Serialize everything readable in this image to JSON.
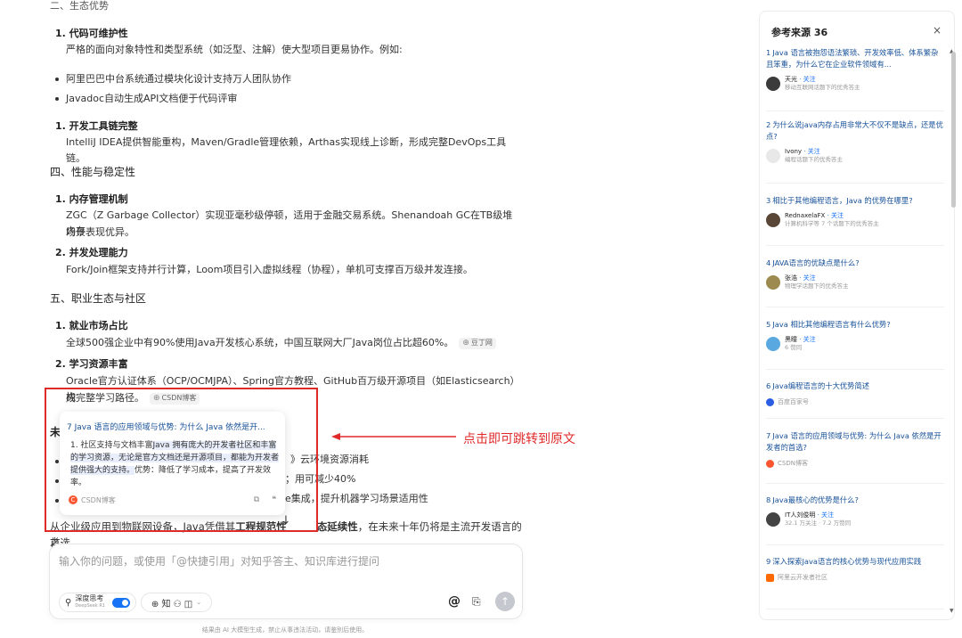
{
  "article": {
    "top_heading": "二、生态优势",
    "item1_title": "1. 代码可维护性",
    "item1_text": "严格的面向对象特性和类型系统（如泛型、注解）使大型项目更易协作。例如:",
    "bullet1": "阿里巴巴中台系统通过模块化设计支持万人团队协作",
    "bullet2": "Javadoc自动生成API文档便于代码评审",
    "item2_title": "1. 开发工具链完整",
    "item2_text": "IntelliJ IDEA提供智能重构，Maven/Gradle管理依赖，Arthas实现线上诊断，形成完整DevOps工具链。",
    "section4": "四、性能与稳定性",
    "item3_title": "1. 内存管理机制",
    "item3_text_a": "ZGC（Z Garbage Collector）实现亚毫秒级停顿，适用于金融交易系统。Shenandoah GC在TB级堆内存",
    "item3_text_b": "场景表现优异。",
    "item4_title": "2. 并发处理能力",
    "item4_text": "Fork/Join框架支持并行计算，Loom项目引入虚拟线程（协程），单机可支撑百万级并发连接。",
    "section5": "五、职业生态与社区",
    "item5_title": "1. 就业市场占比",
    "item5_text": "全球500强企业中有90%使用Java开发核心系统，中国互联网大厂Java岗位占比超60%。",
    "item5_source": "豆丁网",
    "item6_title": "2. 学习资源丰富",
    "item6_text_a": "Oracle官方认证体系（OCP/OCMJPA）、Spring官方教程、GitHub百万级开源项目（如Elasticsearch）构",
    "item6_text_b": "成完整学习路径。",
    "item6_source": "CSDN博客",
    "hidden_head": "未",
    "bullet3_tail": "》云环境资源消耗",
    "bullet4_tail": "；用可减少40%",
    "bullet5_tail": "e集成，提升机器学习场景适用性",
    "conclusion_a": "从企业级应用到物联网设备，Java凭借其",
    "conclusion_b": "工程规范性",
    "conclusion_c": "态延续性",
    "conclusion_d": "，在未来十年仍将是主流开发语言的首选",
    "conclusion_e": "之"
  },
  "popup": {
    "title": "7 Java 语言的应用领域与优势: 为什么 Java 依然是开...",
    "body_prefix": "1. 社区支持与文档丰富",
    "body_highlight": "Java 拥有庞大的开发者社区和丰富的学习资源，无论是官方文档还是开源项目，都能为开发者提供强大的支持。",
    "body_suffix": "优势：降低了学习成本，提高了开发效率。",
    "source": "CSDN博客",
    "csdn_glyph": "C",
    "copy_icon": "⧉",
    "quote_icon": "❝"
  },
  "annotation": "点击即可跳转到原文",
  "scroll_down_icon": "↓",
  "input": {
    "placeholder": "输入你的问题，或使用「@快捷引用」对知乎答主、知识库进行提问",
    "deep_label": "深度思考",
    "deep_sub": "DeepSeek R1",
    "deep_icon": "⚲",
    "tool_icons": "⊕ 知 ⚇ ◫",
    "chevron": "⌄",
    "at_label": "@",
    "clip_icon": "⎘",
    "send_icon": "↑"
  },
  "disclaimer": "结果由 AI 大模型生成，禁止从事违法活动，请鉴别后使用。",
  "panel": {
    "title": "参考来源 36",
    "close_icon": "×",
    "refs": [
      {
        "n": "1",
        "title": "Java 语言被抱怨语法繁琐、开发效率低、体系繁杂且笨重，为什么它在企业软件领域有...",
        "author": "天光",
        "follow": "· 关注",
        "desc": "移动互联网话题下的优秀答主"
      },
      {
        "n": "2",
        "title": "为什么说java内存占用非常大不仅不是缺点，还是优点?",
        "author": "Ivony",
        "follow": "· 关注",
        "desc": "编程话题下的优秀答主"
      },
      {
        "n": "3",
        "title": "相比于其他编程语言，Java 的优势在哪里?",
        "author": "RednaxelaFX",
        "follow": "· 关注",
        "desc": "计算机科学等 7 个话题下的优秀答主"
      },
      {
        "n": "4",
        "title": "JAVA语言的优缺点是什么?",
        "author": "张浩",
        "follow": "· 关注",
        "desc": "物理学话题下的优秀答主"
      },
      {
        "n": "5",
        "title": "Java 相比其他编程语言有什么优势?",
        "author": "黑瞳",
        "follow": "· 关注",
        "desc": "6 赞同"
      },
      {
        "n": "6",
        "title": "Java编程语言的十大优势简述",
        "platform": "百度百家号"
      },
      {
        "n": "7",
        "title": "Java 语言的应用领域与优势: 为什么 Java 依然是开发者的首选?",
        "platform": "CSDN博客"
      },
      {
        "n": "8",
        "title": "Java最核心的优势是什么?",
        "author": "IT人刘俊明",
        "follow": "· 关注",
        "desc": "32.1 万关注 · 7.2 万赞同"
      },
      {
        "n": "9",
        "title": "深入探索Java语言的核心优势与现代应用实践",
        "platform": "阿里云开发者社区"
      }
    ]
  },
  "colors": {
    "link": "#175199",
    "accent": "#1772f6",
    "annotation_red": "#e02a2a",
    "csdn": "#fc5531"
  }
}
